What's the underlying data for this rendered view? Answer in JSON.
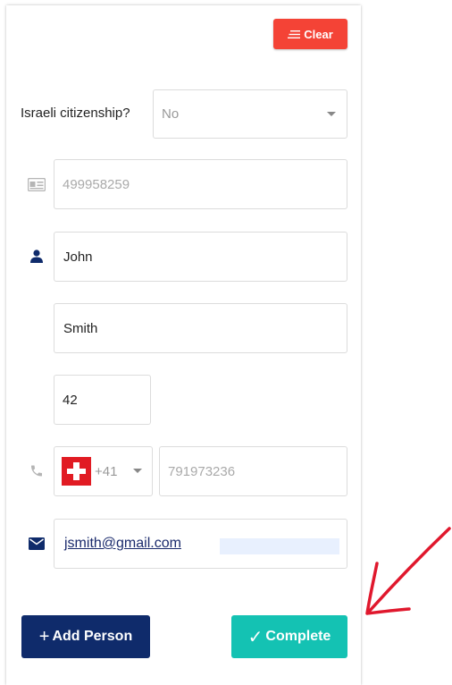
{
  "toolbar": {
    "clear_label": "Clear"
  },
  "form": {
    "citizenship_label": "Israeli citizenship?",
    "citizenship_value": "No",
    "id_placeholder": "499958259",
    "first_name": "John",
    "last_name": "Smith",
    "age": "42",
    "country_code": "+41",
    "phone_placeholder": "791973236",
    "email": "jsmith@gmail.com"
  },
  "actions": {
    "add_person_label": "Add Person",
    "complete_label": "Complete"
  },
  "icons": {
    "id_card": "id-card-icon",
    "person": "person-icon",
    "phone": "phone-icon",
    "email": "envelope-icon",
    "flag": "swiss-flag-icon"
  },
  "colors": {
    "clear": "#f44336",
    "add_person": "#0f2b6b",
    "complete": "#14c2b3",
    "annotation_arrow": "#e0182d"
  }
}
